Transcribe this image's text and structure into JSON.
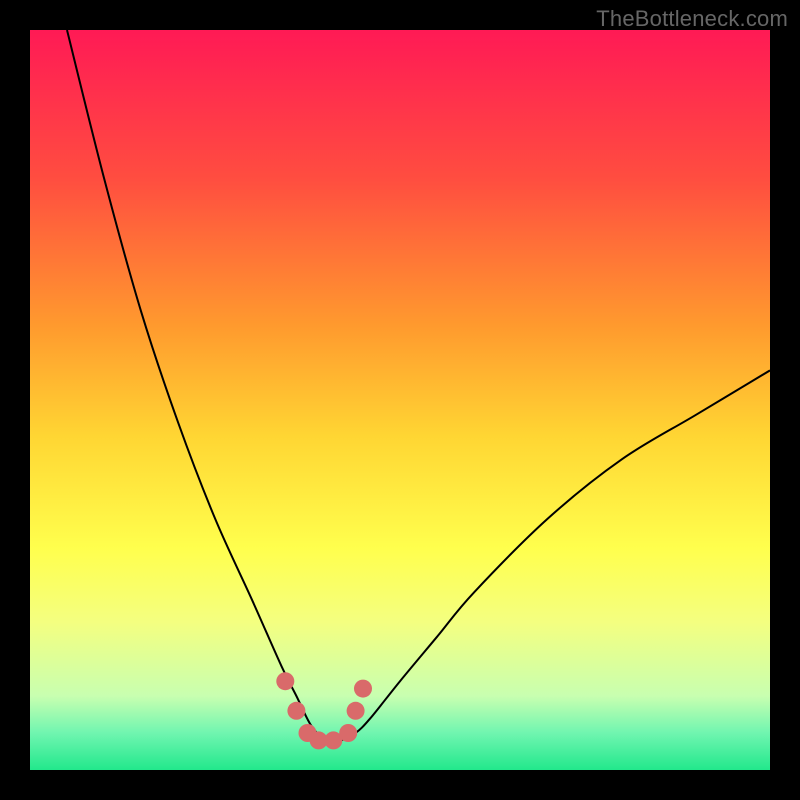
{
  "watermark": "TheBottleneck.com",
  "chart_data": {
    "type": "line",
    "title": "",
    "xlabel": "",
    "ylabel": "",
    "xlim": [
      0,
      100
    ],
    "ylim": [
      0,
      100
    ],
    "series": [
      {
        "name": "bottleneck-curve",
        "x": [
          5,
          10,
          15,
          20,
          25,
          30,
          34,
          36,
          38,
          40,
          42,
          44,
          46,
          50,
          55,
          60,
          70,
          80,
          90,
          100
        ],
        "y": [
          100,
          80,
          62,
          47,
          34,
          23,
          14,
          10,
          6,
          4,
          4,
          5,
          7,
          12,
          18,
          24,
          34,
          42,
          48,
          54
        ]
      }
    ],
    "markers": {
      "name": "highlight-points",
      "color": "#d96a6a",
      "x": [
        34.5,
        36,
        37.5,
        39,
        41,
        43,
        44,
        45
      ],
      "y": [
        12,
        8,
        5,
        4,
        4,
        5,
        8,
        11
      ]
    },
    "background_gradient": {
      "stops": [
        {
          "offset": 0.0,
          "color": "#ff1a55"
        },
        {
          "offset": 0.2,
          "color": "#ff4d40"
        },
        {
          "offset": 0.4,
          "color": "#ff9a2e"
        },
        {
          "offset": 0.55,
          "color": "#ffd633"
        },
        {
          "offset": 0.7,
          "color": "#ffff4d"
        },
        {
          "offset": 0.8,
          "color": "#f4ff80"
        },
        {
          "offset": 0.9,
          "color": "#c8ffb0"
        },
        {
          "offset": 0.95,
          "color": "#70f5b0"
        },
        {
          "offset": 1.0,
          "color": "#22e88c"
        }
      ]
    }
  }
}
